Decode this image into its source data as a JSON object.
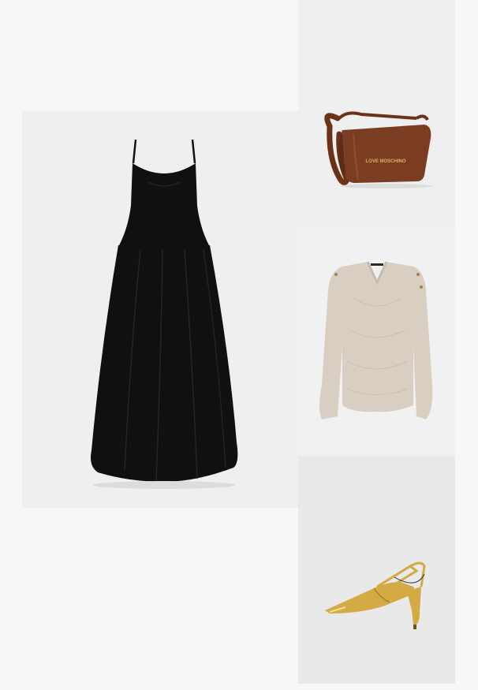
{
  "colors": {
    "page_background": "#f7f7f7",
    "dress_tile": "#efefef",
    "bag_tile": "#efefef",
    "sweater_tile": "#f1f1f1",
    "heels_tile": "#e9e9ea",
    "dress": "#101010",
    "bag": "#7a3d22",
    "sweater": "#d8cfc2",
    "heels": "#d4aa45"
  },
  "items": [
    {
      "id": "dress",
      "icon": "black-maxi-dress-image"
    },
    {
      "id": "bag",
      "icon": "brown-shoulder-bag-image",
      "logo_text": "LOVE MOSCHINO"
    },
    {
      "id": "sweater",
      "icon": "beige-knit-sweater-image"
    },
    {
      "id": "heels",
      "icon": "gold-slingback-pump-image"
    }
  ]
}
